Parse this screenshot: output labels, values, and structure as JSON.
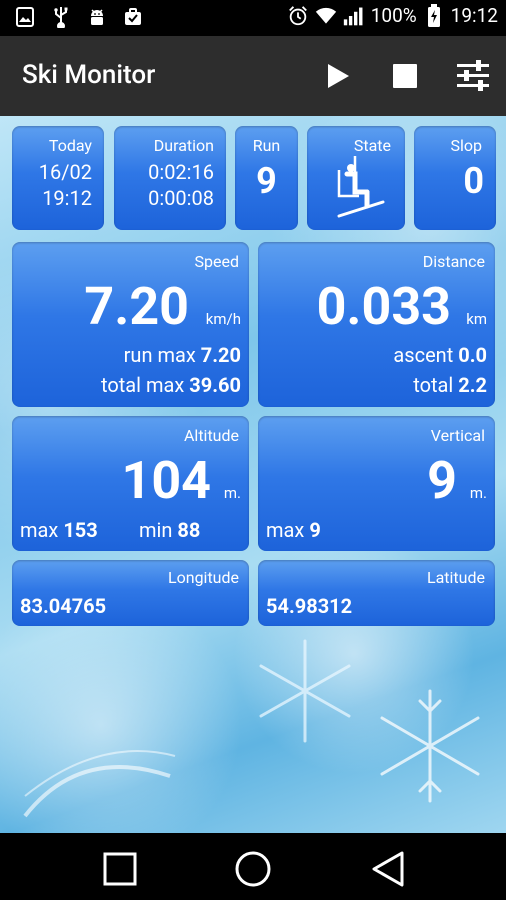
{
  "status_bar": {
    "battery_percent": "100%",
    "time": "19:12",
    "icons": [
      "image-icon",
      "usb-icon",
      "android-debug-icon",
      "briefcase-check-icon",
      "alarm-icon",
      "wifi-icon",
      "signal-icon",
      "battery-icon"
    ]
  },
  "app_bar": {
    "title": "Ski Monitor",
    "actions": [
      "play-icon",
      "stop-icon",
      "settings-sliders-icon"
    ]
  },
  "cards": {
    "today": {
      "label": "Today",
      "date": "16/02",
      "time": "19:12"
    },
    "duration": {
      "label": "Duration",
      "total": "0:02:16",
      "run": "0:00:08"
    },
    "run": {
      "label": "Run",
      "value": "9"
    },
    "state": {
      "label": "State",
      "icon": "ski-lift-icon"
    },
    "slope": {
      "label": "Slop",
      "value": "0"
    },
    "speed": {
      "label": "Speed",
      "value": "7.20",
      "unit": "km/h",
      "run_max_label": "run max",
      "run_max": "7.20",
      "total_max_label": "total max",
      "total_max": "39.60"
    },
    "distance": {
      "label": "Distance",
      "value": "0.033",
      "unit": "km",
      "ascent_label": "ascent",
      "ascent": "0.0",
      "total_label": "total",
      "total": "2.2"
    },
    "altitude": {
      "label": "Altitude",
      "value": "104",
      "unit": "m.",
      "max_label": "max",
      "max": "153",
      "min_label": "min",
      "min": "88"
    },
    "vertical": {
      "label": "Vertical",
      "value": "9",
      "unit": "m.",
      "max_label": "max",
      "max": "9"
    },
    "longitude": {
      "label": "Longitude",
      "value": "83.04765"
    },
    "latitude": {
      "label": "Latitude",
      "value": "54.98312"
    }
  },
  "nav_bar": {
    "buttons": [
      "recents-square-icon",
      "home-circle-icon",
      "back-triangle-icon"
    ]
  }
}
